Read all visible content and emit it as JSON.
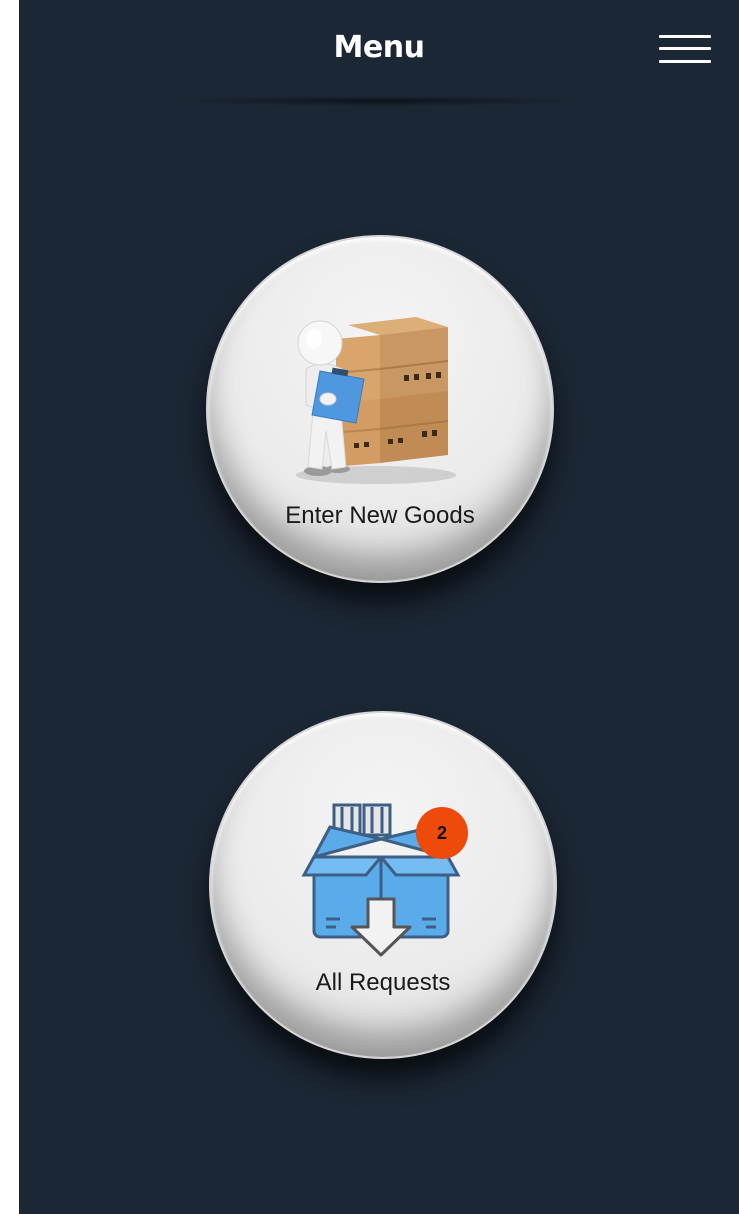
{
  "header": {
    "title": "Menu",
    "menu_icon": "hamburger-menu-icon"
  },
  "menu": {
    "items": [
      {
        "label": "Enter New Goods",
        "icon": "person-with-boxes-clipboard-icon"
      },
      {
        "label": "All Requests",
        "icon": "open-box-download-icon",
        "badge": "2"
      }
    ]
  },
  "colors": {
    "background": "#1c2735",
    "tile": "#ebebeb",
    "badge": "#ee4a0b",
    "box_blue": "#5aabea",
    "cardboard": "#c89762"
  }
}
